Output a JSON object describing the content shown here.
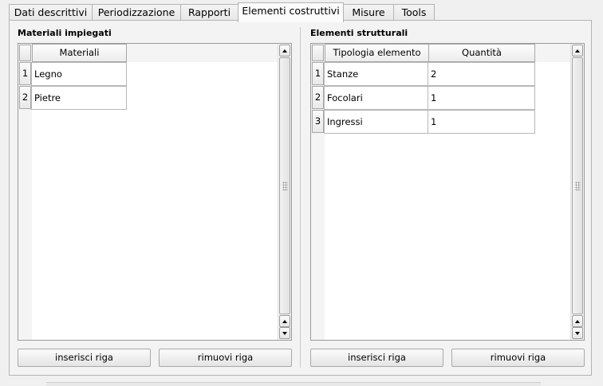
{
  "tabs": [
    {
      "label": "Dati descrittivi"
    },
    {
      "label": "Periodizzazione"
    },
    {
      "label": "Rapporti"
    },
    {
      "label": "Elementi costruttivi"
    },
    {
      "label": "Misure"
    },
    {
      "label": "Tools"
    }
  ],
  "active_tab": "Elementi costruttivi",
  "left_section": {
    "title": "Materiali impiegati",
    "columns": [
      "Materiali"
    ],
    "rows": [
      {
        "index": "1",
        "cells": [
          "Legno"
        ]
      },
      {
        "index": "2",
        "cells": [
          "Pietre"
        ]
      }
    ],
    "add_button": "inserisci riga",
    "remove_button": "rimuovi riga"
  },
  "right_section": {
    "title": "Elementi strutturali",
    "columns": [
      "Tipologia elemento",
      "Quantità"
    ],
    "rows": [
      {
        "index": "1",
        "cells": [
          "Stanze",
          "2"
        ]
      },
      {
        "index": "2",
        "cells": [
          "Focolari",
          "1"
        ]
      },
      {
        "index": "3",
        "cells": [
          "Ingressi",
          "1"
        ]
      }
    ],
    "add_button": "inserisci riga",
    "remove_button": "rimuovi riga"
  },
  "icons": {
    "scroll_up": "triangle-up",
    "scroll_down": "triangle-down",
    "scroll_grip": "dotted-grip"
  }
}
